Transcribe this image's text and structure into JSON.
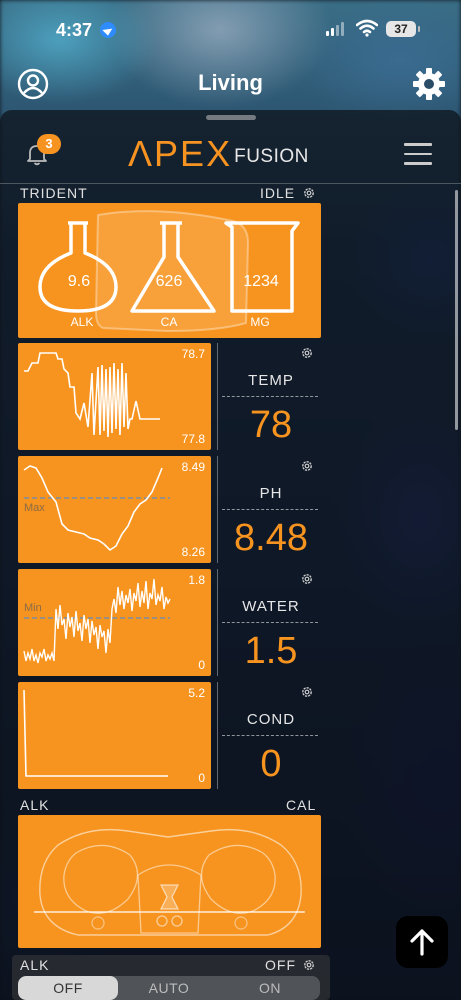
{
  "status_bar": {
    "time": "4:37",
    "battery": "37"
  },
  "app_bar": {
    "title": "Living"
  },
  "header": {
    "notification_count": "3",
    "logo_main": "ΛPEX",
    "logo_sub": "FUSION"
  },
  "trident": {
    "label": "TRIDENT",
    "state": "IDLE",
    "alk_value": "9.6",
    "alk_label": "ALK",
    "ca_value": "626",
    "ca_label": "CA",
    "mg_value": "1234",
    "mg_label": "MG"
  },
  "probes": [
    {
      "name": "TEMP",
      "value": "78",
      "graph_max": "78.7",
      "graph_min": "77.8",
      "line_label": ""
    },
    {
      "name": "PH",
      "value": "8.48",
      "graph_max": "8.49",
      "graph_min": "8.26",
      "line_label": "Max"
    },
    {
      "name": "WATER",
      "value": "1.5",
      "graph_max": "1.8",
      "graph_min": "0",
      "line_label": "Min"
    },
    {
      "name": "COND",
      "value": "0",
      "graph_max": "5.2",
      "graph_min": "0",
      "line_label": ""
    }
  ],
  "doser": {
    "left_label": "ALK",
    "right_label": "CAL"
  },
  "output": {
    "name": "ALK",
    "state": "OFF",
    "options": [
      "OFF",
      "AUTO",
      "ON"
    ],
    "selected": "OFF"
  },
  "colors": {
    "accent": "#f7941f",
    "notification": "#f79321"
  },
  "icons": [
    "profile-icon",
    "settings-gear-icon",
    "bell-icon",
    "hamburger-menu-icon",
    "gear-icon",
    "arrow-up-icon"
  ]
}
